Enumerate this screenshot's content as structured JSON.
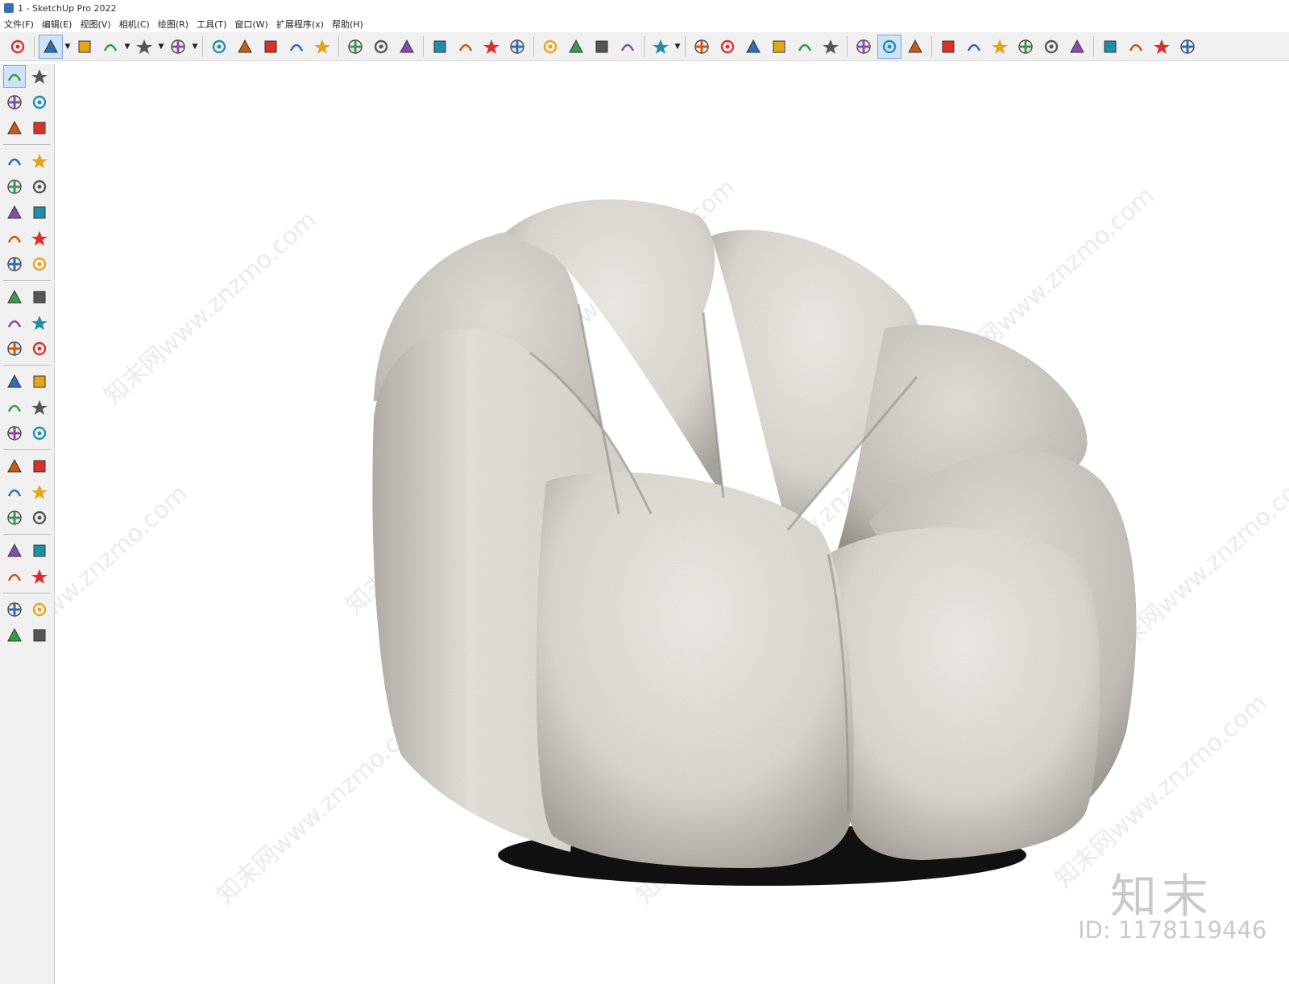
{
  "window": {
    "title": "1 - SketchUp Pro 2022"
  },
  "menu": [
    "文件(F)",
    "编辑(E)",
    "视图(V)",
    "相机(C)",
    "绘图(R)",
    "工具(T)",
    "窗口(W)",
    "扩展程序(x)",
    "帮助(H)"
  ],
  "toolbar_icons": [
    "search-icon",
    "select-icon",
    "eraser-icon",
    "pencil-icon",
    "arc-icon",
    "rectangle-icon",
    "pushpull-icon",
    "followme-icon",
    "move-icon",
    "rotate-icon",
    "scale-icon",
    "tape-measure-icon",
    "text-icon",
    "paint-bucket-icon",
    "orbit-icon",
    "pan-icon",
    "zoom-icon",
    "zoom-extents-icon",
    "warehouse-icon",
    "extension-icon",
    "layers-icon",
    "settings-icon",
    "user-icon",
    "iso-view-icon",
    "top-view-icon",
    "front-view-icon",
    "right-view-icon",
    "back-view-icon",
    "left-view-icon",
    "section-plane-icon",
    "section-display-icon",
    "camera-icon",
    "add-location-icon",
    "shield-icon",
    "styles-icon",
    "checker-icon",
    "cloud-icon",
    "gear-icon",
    "chat-icon",
    "info-icon",
    "cart-icon",
    "account-icon"
  ],
  "left_tools": [
    "select-tool",
    "orbit-tool",
    "paint-tool",
    "eraser-tool",
    "component-tool",
    "tag-tool",
    "line-tool",
    "freehand-tool",
    "rectangle-tool",
    "rotated-rectangle-tool",
    "circle-tool",
    "polygon-tool",
    "arc-tool",
    "two-point-arc-tool",
    "three-point-arc-tool",
    "pie-tool",
    "move-tool",
    "pushpull-tool",
    "rotate-tool",
    "followme-tool",
    "scale-tool",
    "offset-tool",
    "tape-tool",
    "dimension-tool",
    "protractor-tool",
    "text-tool",
    "axes-tool",
    "3d-text-tool",
    "orbit-tool-2",
    "pan-tool",
    "zoom-tool",
    "zoom-window-tool",
    "zoom-extents-tool",
    "previous-tool",
    "position-camera-tool",
    "look-around-tool",
    "walk-tool",
    "section-tool",
    "warehouse-tool",
    "extension-tool",
    "layer-tool",
    "settings-tool"
  ],
  "watermark": {
    "text": "知末网www.znzmo.com",
    "logo": "知末",
    "id": "ID: 1178119446"
  },
  "colors": {
    "accent": "#cfe3f7",
    "fabric": "#e8e4de",
    "base": "#1a1a1a"
  }
}
